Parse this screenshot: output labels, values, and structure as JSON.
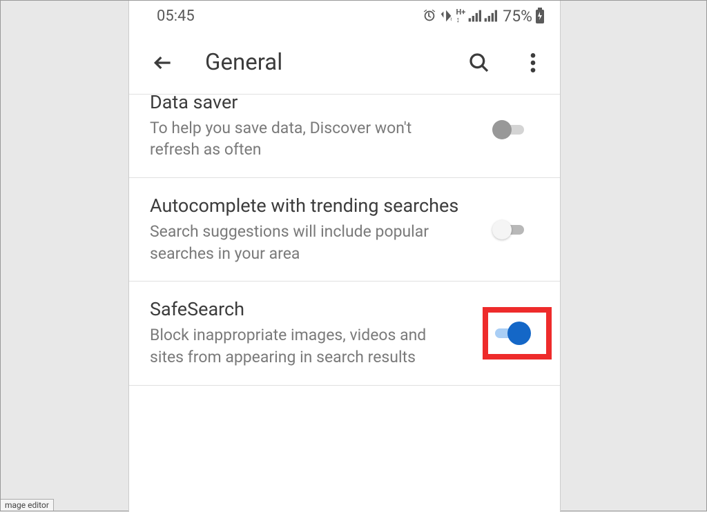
{
  "status": {
    "time": "05:45",
    "battery": "75%"
  },
  "appbar": {
    "title": "General"
  },
  "settings": [
    {
      "title": "Data saver",
      "desc": "To help you save data, Discover won't refresh as often"
    },
    {
      "title": "Autocomplete with trending searches",
      "desc": "Search suggestions will include popular searches in your area"
    },
    {
      "title": "SafeSearch",
      "desc": "Block inappropriate images, videos and sites from appearing in search results"
    }
  ],
  "footer": "mage editor"
}
